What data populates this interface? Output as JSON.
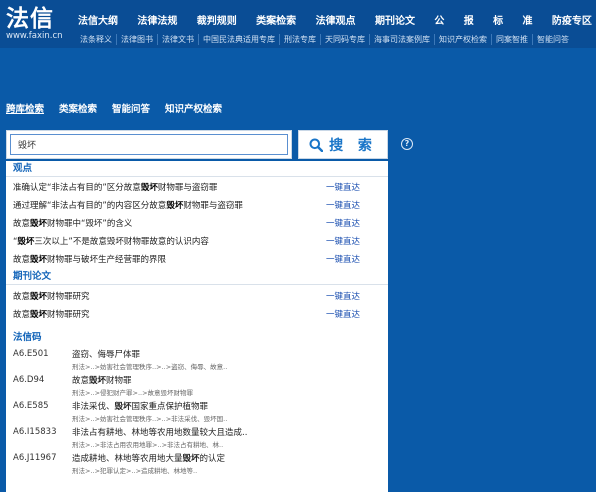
{
  "logo": {
    "cn": "法信",
    "en": "www.faxin.cn"
  },
  "main_nav": [
    "法信大纲",
    "法律法规",
    "裁判规则",
    "类案检索",
    "法律观点",
    "期刊论文",
    "公",
    "报",
    "标",
    "准",
    "防疫专区"
  ],
  "sub_nav": [
    "法条释义",
    "法律图书",
    "法律文书",
    "中国民法典适用专库",
    "刑法专库",
    "天同码专库",
    "海事司法案例库",
    "知识产权检索",
    "同案智推",
    "智能问答"
  ],
  "search_tabs": [
    "跨库检索",
    "类案检索",
    "智能问答",
    "知识产权检索"
  ],
  "search": {
    "value": "毁坏",
    "button_label": "搜 索",
    "help": "?"
  },
  "dropdown": {
    "viewpoints_title": "观点",
    "viewpoints": [
      {
        "pre": "准确认定“非法占有目的”区分故意",
        "hl": "毁坏",
        "post": "财物罪与盗窃罪",
        "action": "一键直达"
      },
      {
        "pre": "通过理解“非法占有目的”的内容区分故意",
        "hl": "毁坏",
        "post": "财物罪与盗窃罪",
        "action": "一键直达"
      },
      {
        "pre": "故意",
        "hl": "毁坏",
        "post": "财物罪中“毁坏”的含义",
        "action": "一键直达"
      },
      {
        "pre": "“",
        "hl": "毁坏",
        "post": "三次以上”不是故意毁坏财物罪故意的认识内容",
        "action": "一键直达"
      },
      {
        "pre": "故意",
        "hl": "毁坏",
        "post": "财物罪与破坏生产经营罪的界限",
        "action": "一键直达"
      }
    ],
    "journals_title": "期刊论文",
    "journals": [
      {
        "pre": "故意",
        "hl": "毁坏",
        "post": "财物罪研究",
        "action": "一键直达"
      },
      {
        "pre": "故意",
        "hl": "毁坏",
        "post": "财物罪研究",
        "action": "一键直达"
      }
    ],
    "codes_title": "法信码",
    "codes": [
      {
        "code": "A6.E501",
        "pre": "盗窃、侮辱尸体罪",
        "hl": "",
        "post": "",
        "path": "刑法>..>妨害社会管理秩序..>..>盗窃、侮辱、故意.."
      },
      {
        "code": "A6.D94",
        "pre": "故意",
        "hl": "毁坏",
        "post": "财物罪",
        "path": "刑法>..>侵犯财产罪>..>故意毁坏财物罪"
      },
      {
        "code": "A6.E585",
        "pre": "非法采伐、",
        "hl": "毁坏",
        "post": "国家重点保护植物罪",
        "path": "刑法>..>妨害社会管理秩序..>..>非法采伐、毁坏国.."
      },
      {
        "code": "A6.I15833",
        "pre": "非法占有耕地、林地等农用地数量较大且造成..",
        "hl": "",
        "post": "",
        "path": "刑法>..>非法占用农用地罪>..>非法占有耕地、林.."
      },
      {
        "code": "A6.J11967",
        "pre": "造成耕地、林地等农用地大量",
        "hl": "毁坏",
        "post": "的认定",
        "path": "刑法>..>犯罪认定>..>造成耕地、林地等.."
      }
    ]
  }
}
